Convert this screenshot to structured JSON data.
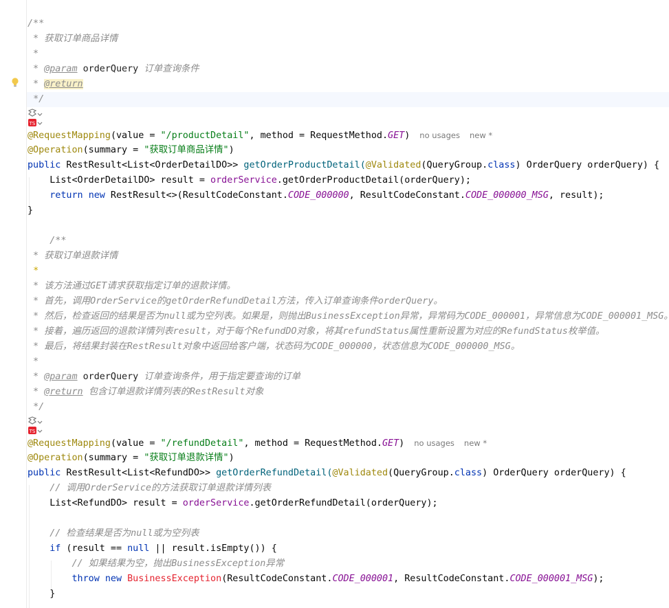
{
  "doc1": {
    "open": "/**",
    "title": "获取订单商品详情",
    "param_tag": "@param",
    "param_name": "orderQuery",
    "param_desc": "订单查询条件",
    "return_tag": "@return",
    "close": "*/"
  },
  "method1": {
    "mapping_ann": "@RequestMapping",
    "mapping_args_pre": "(value = ",
    "mapping_path": "\"/productDetail\"",
    "mapping_args_mid": ", method = RequestMethod.",
    "mapping_method": "GET",
    "mapping_args_post": ")",
    "hint_usages": "no usages",
    "hint_new": "new *",
    "operation_ann": "@Operation",
    "operation_pre": "(summary = ",
    "operation_summary": "\"获取订单商品详情\"",
    "operation_post": ")",
    "kw_public": "public",
    "sig_type": " RestResult<List<OrderDetailDO>> ",
    "sig_name": "getOrderProductDetail(",
    "validated_ann": "@Validated",
    "sig_group": "(QueryGroup.",
    "kw_class": "class",
    "sig_rest": ") OrderQuery orderQuery) {",
    "body1_pre": "List<OrderDetailDO> result = ",
    "body1_field": "orderService",
    "body1_post": ".getOrderProductDetail(orderQuery);",
    "kw_return": "return",
    "kw_new": "new",
    "body2_a": " RestResult<>(ResultCodeConstant.",
    "const_code": "CODE_000000",
    "body2_b": ", ResultCodeConstant.",
    "const_msg": "CODE_000000_MSG",
    "body2_c": ", result);",
    "close_brace": "}"
  },
  "doc2": {
    "open": "/**",
    "title": "获取订单退款详情",
    "star": "*",
    "line1": "该方法通过GET请求获取指定订单的退款详情。",
    "line2": "首先，调用OrderService的getOrderRefundDetail方法，传入订单查询条件orderQuery。",
    "line3": "然后，检查返回的结果是否为null或为空列表。如果是，则抛出BusinessException异常，异常码为CODE_000001，异常信息为CODE_000001_MSG。",
    "line4": "接着，遍历返回的退款详情列表result，对于每个RefundDO对象，将其refundStatus属性重新设置为对应的RefundStatus枚举值。",
    "line5": "最后，将结果封装在RestResult对象中返回给客户端，状态码为CODE_000000，状态信息为CODE_000000_MSG。",
    "param_tag": "@param",
    "param_name": "orderQuery",
    "param_desc": "订单查询条件，用于指定要查询的订单",
    "return_tag": "@return",
    "return_desc": "包含订单退款详情列表的RestResult对象",
    "close": "*/"
  },
  "method2": {
    "mapping_ann": "@RequestMapping",
    "mapping_args_pre": "(value = ",
    "mapping_path": "\"/refundDetail\"",
    "mapping_args_mid": ", method = RequestMethod.",
    "mapping_method": "GET",
    "mapping_args_post": ")",
    "hint_usages": "no usages",
    "hint_new": "new *",
    "operation_ann": "@Operation",
    "operation_pre": "(summary = ",
    "operation_summary": "\"获取订单退款详情\"",
    "operation_post": ")",
    "kw_public": "public",
    "sig_type": " RestResult<List<RefundDO>> ",
    "sig_name": "getOrderRefundDetail(",
    "validated_ann": "@Validated",
    "sig_group": "(QueryGroup.",
    "kw_class": "class",
    "sig_rest": ") OrderQuery orderQuery) {",
    "comment1": "// 调用OrderService的方法获取订单退款详情列表",
    "body1_pre": "List<RefundDO> result = ",
    "body1_field": "orderService",
    "body1_post": ".getOrderRefundDetail(orderQuery);",
    "comment2": "// 检查结果是否为null或为空列表",
    "kw_if": "if",
    "if_a": " (result == ",
    "kw_null": "null",
    "if_b": " || result.isEmpty()) {",
    "comment3": "// 如果结果为空，抛出BusinessException异常",
    "kw_throw": "throw",
    "kw_new": "new",
    "exc_name": "BusinessException",
    "throw_a": "(ResultCodeConstant.",
    "const_code": "CODE_000001",
    "throw_b": ", ResultCodeConstant.",
    "const_msg": "CODE_000001_MSG",
    "throw_c": ");",
    "close_brace": "}"
  },
  "colors": {
    "keyword": "#0033b3",
    "string": "#067d17",
    "annotation": "#9e880d",
    "field": "#871094",
    "comment": "#8c8c8c",
    "error_class": "#e5232f",
    "caret_row": "#f5f8fe"
  },
  "gutter_icons": [
    "lightbulb-icon",
    "ai-assistant-icon",
    "plugin-badge-icon"
  ]
}
